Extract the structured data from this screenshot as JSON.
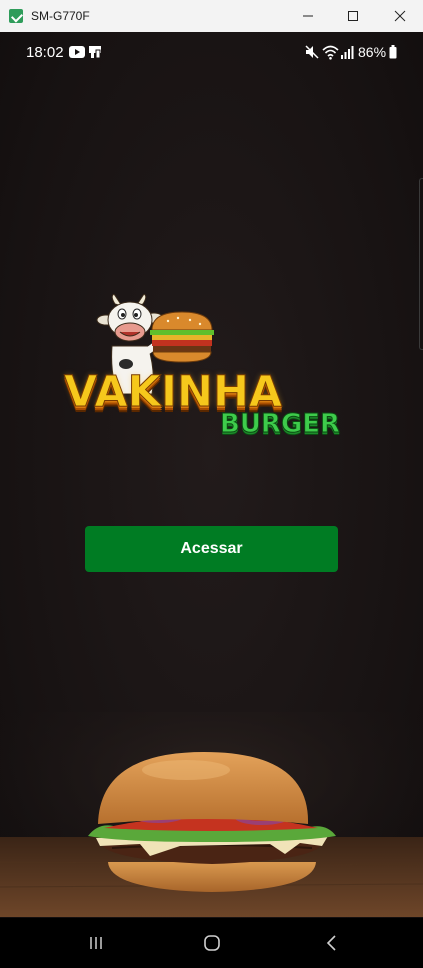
{
  "window": {
    "title": "SM-G770F",
    "icons": {
      "app": "app-icon",
      "minimize": "minimize-icon",
      "maximize": "maximize-icon",
      "close": "close-icon"
    }
  },
  "status_bar": {
    "time": "18:02",
    "battery_percent": "86%",
    "icons": [
      "youtube-icon",
      "notification-icon",
      "mute-icon",
      "wifi-icon",
      "signal-icon",
      "battery-icon"
    ]
  },
  "logo": {
    "wordmark": "VAKINHA",
    "subtitle": "BURGER",
    "mascot": "cow-mascot-icon"
  },
  "actions": {
    "access_label": "Acessar"
  },
  "nav_bar": {
    "icons": [
      "recents-icon",
      "home-icon",
      "back-icon"
    ]
  },
  "colors": {
    "background": "#171212",
    "primary_button": "#007c23",
    "button_text": "#ffffff",
    "wordmark": "#f6c81c",
    "subtitle": "#3ecb4b"
  }
}
